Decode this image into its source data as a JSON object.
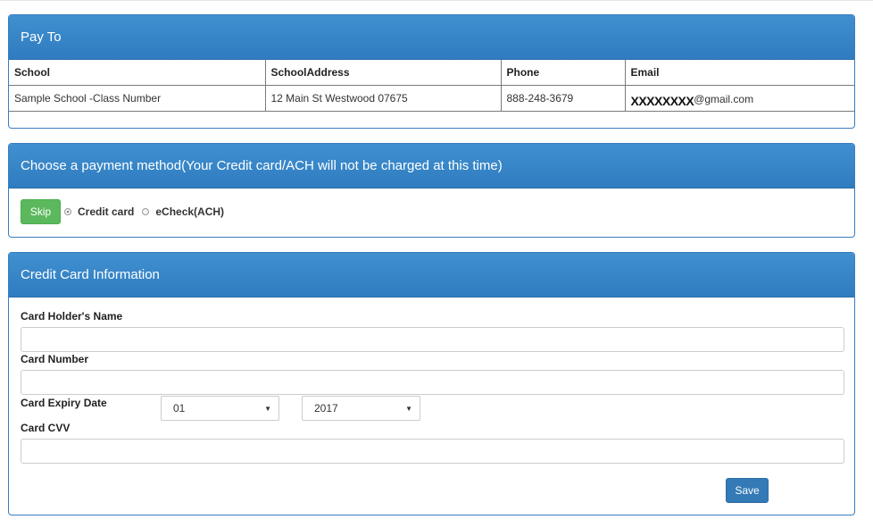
{
  "pay_to": {
    "heading": "Pay To",
    "columns": [
      "School",
      "SchoolAddress",
      "Phone",
      "Email"
    ],
    "row": {
      "school": "Sample School -Class Number",
      "address": "12 Main St Westwood 07675",
      "phone": "888-248-3679",
      "email_mask": "XXXXXXXX",
      "email_domain": "@gmail.com"
    }
  },
  "payment_method": {
    "heading": "Choose a payment method(Your Credit card/ACH will not be charged at this time)",
    "skip_label": "Skip",
    "options": [
      "Credit card",
      "eCheck(ACH)"
    ],
    "selected": "Credit card"
  },
  "credit_card": {
    "heading": "Credit Card Information",
    "holder_label": "Card Holder's Name",
    "holder_value": "",
    "number_label": "Card Number",
    "number_value": "",
    "expiry_label": "Card Expiry Date",
    "expiry_month": "01",
    "expiry_year": "2017",
    "cvv_label": "Card CVV",
    "cvv_value": "",
    "save_label": "Save"
  },
  "colors": {
    "panel_header": "#337ab7",
    "skip_button": "#5cb85c",
    "save_button": "#337ab7"
  }
}
